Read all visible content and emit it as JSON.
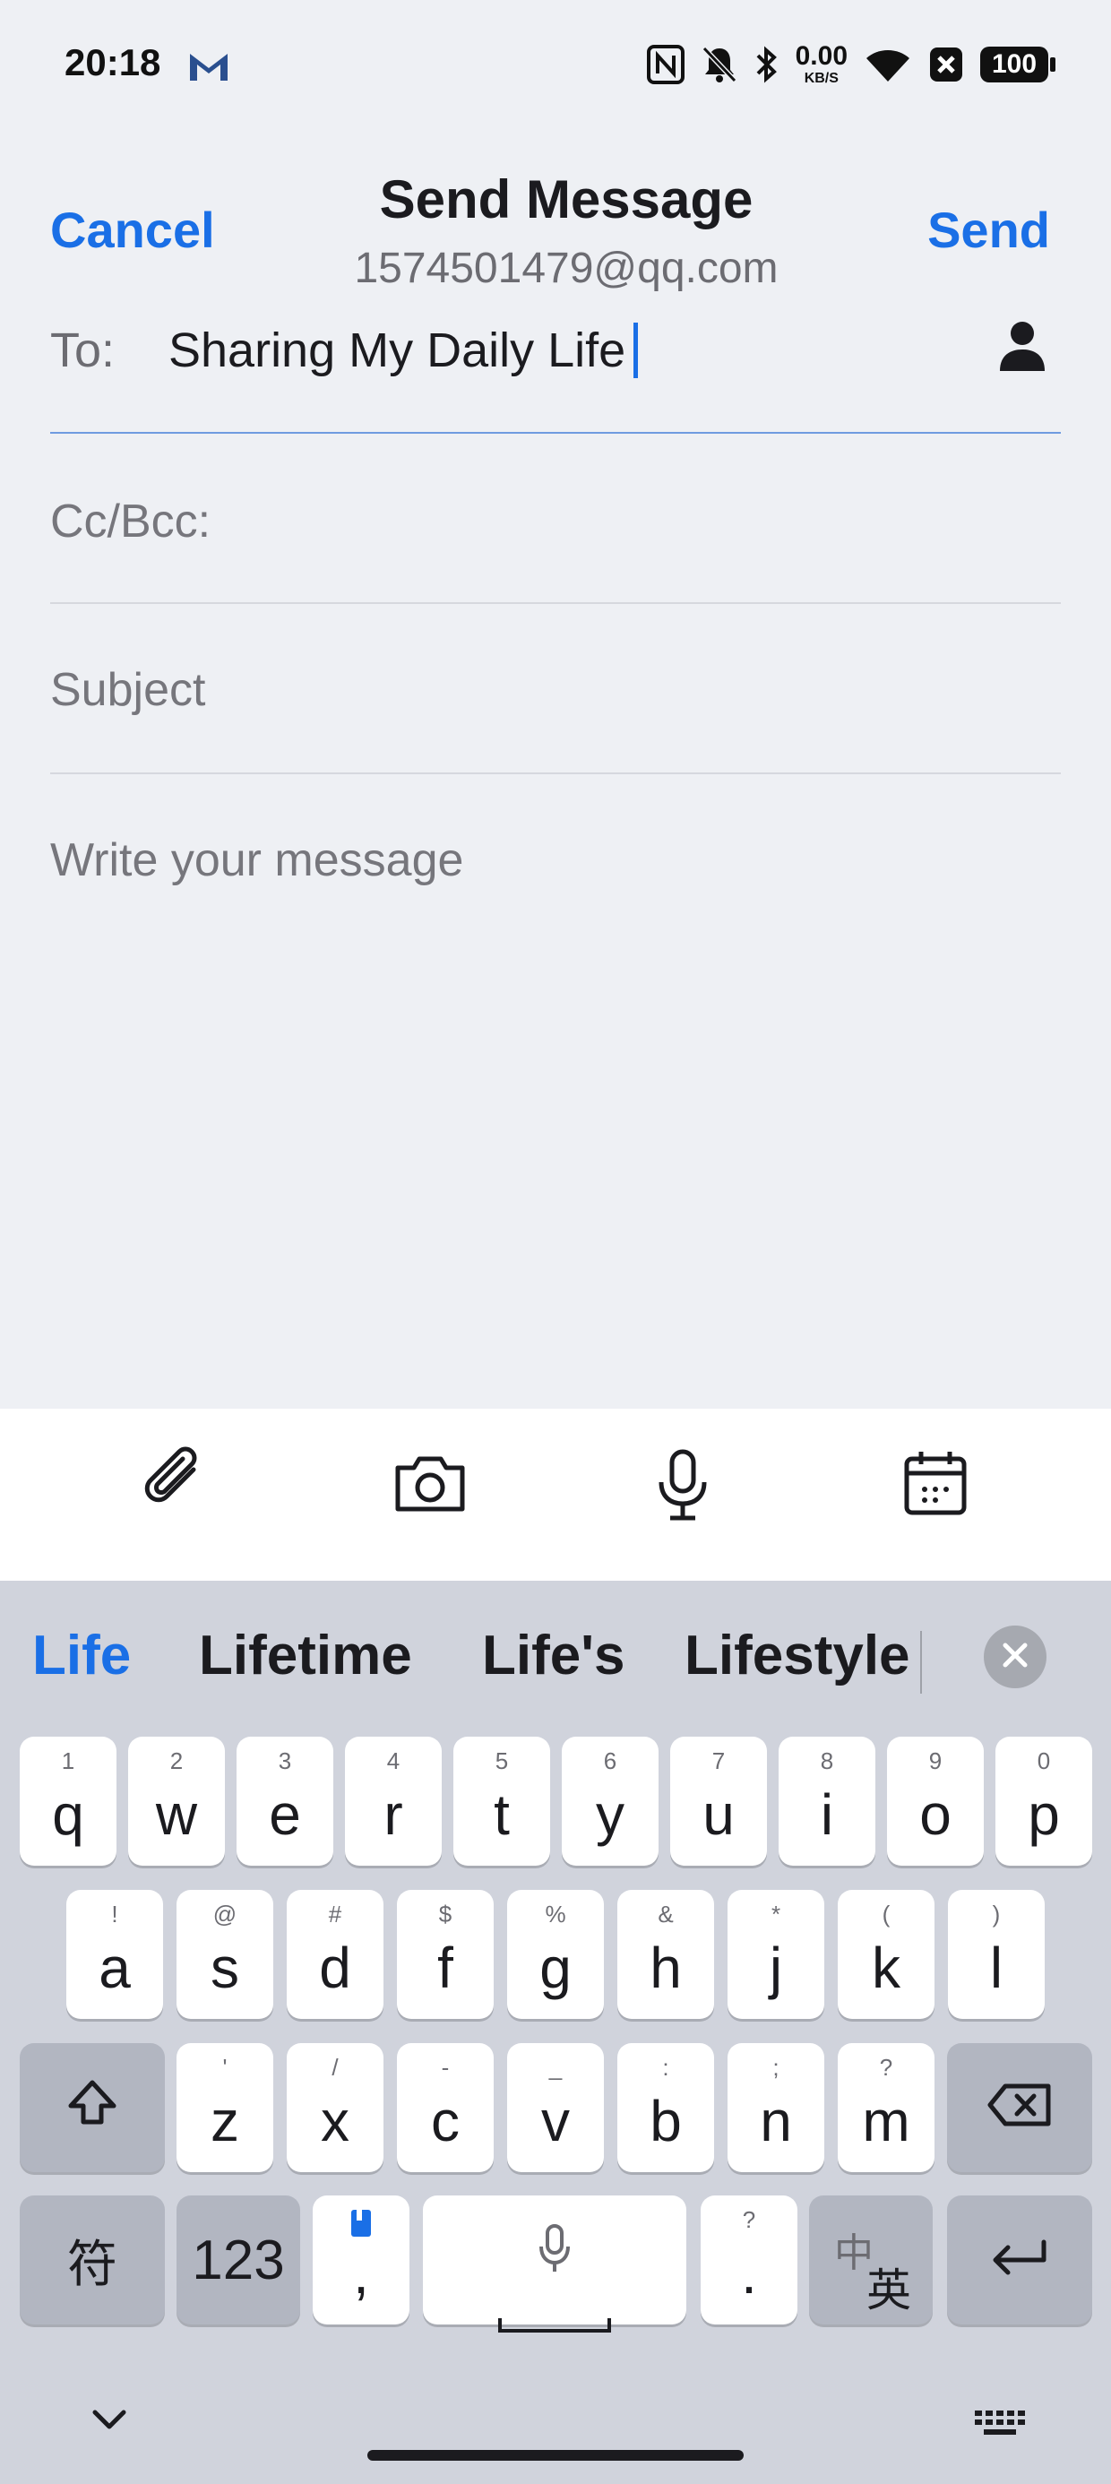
{
  "status_bar": {
    "time": "20:18",
    "net_speed_value": "0.00",
    "net_speed_unit": "KB/S",
    "battery": "100",
    "icons": [
      "gmail-icon",
      "nfc-icon",
      "bell-off-icon",
      "bluetooth-icon",
      "wifi-icon",
      "blocked-app-icon",
      "battery-icon"
    ]
  },
  "header": {
    "cancel_label": "Cancel",
    "title": "Send Message",
    "from_address": "1574501479@qq.com",
    "send_label": "Send"
  },
  "fields": {
    "to_label": "To:",
    "to_value": "Sharing My Daily Life",
    "cc_label": "Cc/Bcc:",
    "subject_placeholder": "Subject",
    "message_placeholder": "Write your message"
  },
  "toolbar": {
    "items": [
      "attachment-icon",
      "camera-icon",
      "microphone-icon",
      "calendar-icon"
    ]
  },
  "keyboard": {
    "suggestions": [
      "Life",
      "Lifetime",
      "Life's",
      "Lifestyle"
    ],
    "row1": [
      {
        "main": "q",
        "hint": "1"
      },
      {
        "main": "w",
        "hint": "2"
      },
      {
        "main": "e",
        "hint": "3"
      },
      {
        "main": "r",
        "hint": "4"
      },
      {
        "main": "t",
        "hint": "5"
      },
      {
        "main": "y",
        "hint": "6"
      },
      {
        "main": "u",
        "hint": "7"
      },
      {
        "main": "i",
        "hint": "8"
      },
      {
        "main": "o",
        "hint": "9"
      },
      {
        "main": "p",
        "hint": "0"
      }
    ],
    "row2": [
      {
        "main": "a",
        "hint": "!"
      },
      {
        "main": "s",
        "hint": "@"
      },
      {
        "main": "d",
        "hint": "#"
      },
      {
        "main": "f",
        "hint": "$"
      },
      {
        "main": "g",
        "hint": "%"
      },
      {
        "main": "h",
        "hint": "&"
      },
      {
        "main": "j",
        "hint": "*"
      },
      {
        "main": "k",
        "hint": "("
      },
      {
        "main": "l",
        "hint": ")"
      }
    ],
    "row3": [
      {
        "main": "z",
        "hint": "'"
      },
      {
        "main": "x",
        "hint": "/"
      },
      {
        "main": "c",
        "hint": "-"
      },
      {
        "main": "v",
        "hint": "_"
      },
      {
        "main": "b",
        "hint": ":"
      },
      {
        "main": "n",
        "hint": ";"
      },
      {
        "main": "m",
        "hint": "?"
      }
    ],
    "symbols_key": "符",
    "numbers_key": "123",
    "comma_key": ",",
    "period_key": ".",
    "period_hint": "?",
    "lang_key_top": "中",
    "lang_key_bottom": "英"
  }
}
